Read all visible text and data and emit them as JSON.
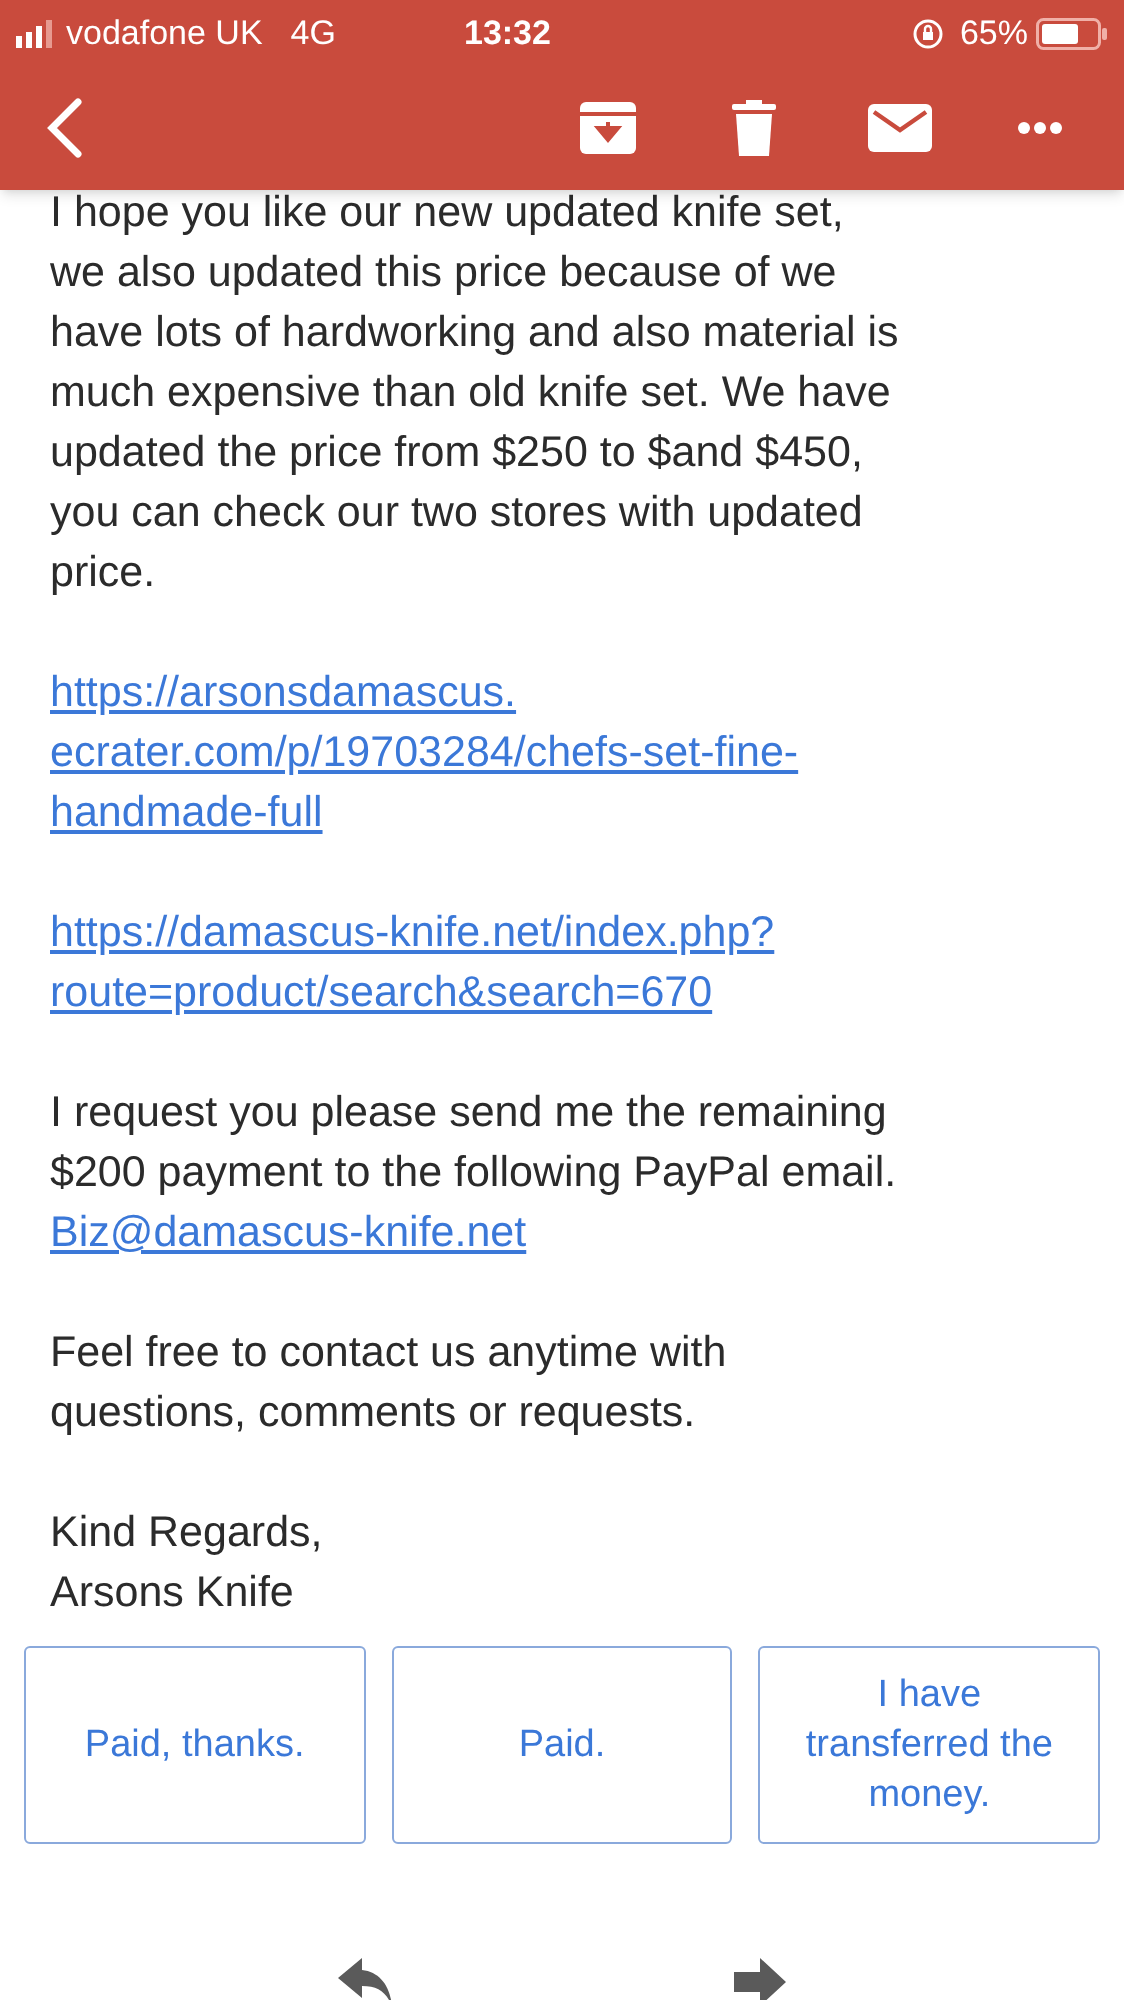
{
  "status_bar": {
    "carrier": "vodafone UK",
    "network": "4G",
    "time": "13:32",
    "battery": "65%"
  },
  "body": [
    {
      "kind": "text",
      "lines": [
        "I hope you like our new updated knife set,",
        "we also updated this price because of we",
        "have lots of hardworking and also material is",
        "much expensive than old knife set. We have",
        "updated the price from $250 to $and $450,",
        "you can check our two stores with updated",
        "price."
      ]
    },
    {
      "kind": "link",
      "lines": [
        "https://arsonsdamascus.",
        "ecrater.com/p/19703284/chefs-set-fine-",
        "handmade-full"
      ]
    },
    {
      "kind": "link",
      "lines": [
        "https://damascus-knife.net/index.php?",
        "route=product/search&search=670"
      ]
    },
    {
      "kind": "text",
      "lines": [
        "I request you please send me the remaining",
        "$200 payment to the following PayPal email."
      ],
      "link": "Biz@damascus-knife.net"
    },
    {
      "kind": "text",
      "lines": [
        "Feel free to contact us anytime with",
        "questions, comments or requests."
      ]
    },
    {
      "kind": "text",
      "lines": [
        "Kind Regards,",
        "Arsons Knife"
      ]
    }
  ],
  "smart_replies": [
    "Paid, thanks.",
    "Paid.",
    "I have transferred the money."
  ]
}
